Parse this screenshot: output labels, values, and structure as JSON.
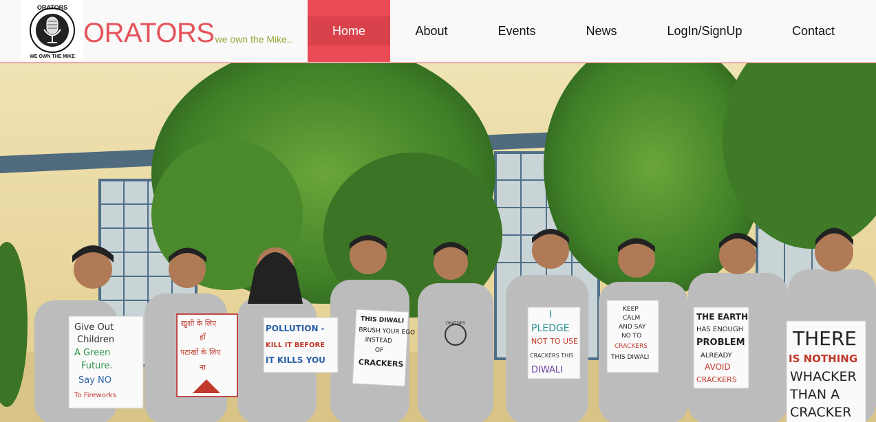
{
  "header": {
    "brand_name": "ORATORS",
    "tagline": "we own the Mike..",
    "logo": {
      "icon": "microphone-icon",
      "top_text": "ORATORS",
      "bottom_text": "WE OWN THE MIKE"
    }
  },
  "nav": {
    "items": [
      {
        "label": "Home",
        "active": true
      },
      {
        "label": "About"
      },
      {
        "label": "Events"
      },
      {
        "label": "News"
      },
      {
        "label": "LogIn/SignUp"
      },
      {
        "label": "Contact"
      }
    ]
  },
  "hero": {
    "posters": [
      {
        "lines": [
          "Give Out",
          "Children",
          "A Green",
          "Future.",
          "Say NO",
          "To Fireworks"
        ]
      },
      {
        "lines": [
          "ख़ुशी के लिए",
          "हाँ",
          "पटाखों के लिए",
          "ना"
        ]
      },
      {
        "lines": [
          "POLLUTION -",
          "KILL IT BEFORE",
          "IT KILLS YOU"
        ]
      },
      {
        "lines": [
          "THIS DIWALI",
          "BRUSH YOUR EGO",
          "INSTEAD",
          "OF",
          "CRACKERS"
        ]
      },
      {
        "lines": [
          "I",
          "PLEDGE",
          "NOT TO USE",
          "CRACKERS THIS",
          "DIWALI"
        ]
      },
      {
        "lines": [
          "KEEP",
          "CALM",
          "AND SAY",
          "NO TO",
          "CRACKERS",
          "THIS DIWALI"
        ]
      },
      {
        "lines": [
          "THE EARTH",
          "HAS ENOUGH",
          "PROBLEM",
          "ALREADY",
          "AVOID",
          "CRACKERS"
        ]
      },
      {
        "lines": [
          "THERE",
          "IS NOTHING",
          "WHACKER",
          "THAN A",
          "CRACKER"
        ]
      }
    ],
    "tshirt_text": "ORATORS"
  },
  "colors": {
    "accent": "#e5535a",
    "nav_active": "#ea4a54",
    "tagline": "#97a83e"
  }
}
